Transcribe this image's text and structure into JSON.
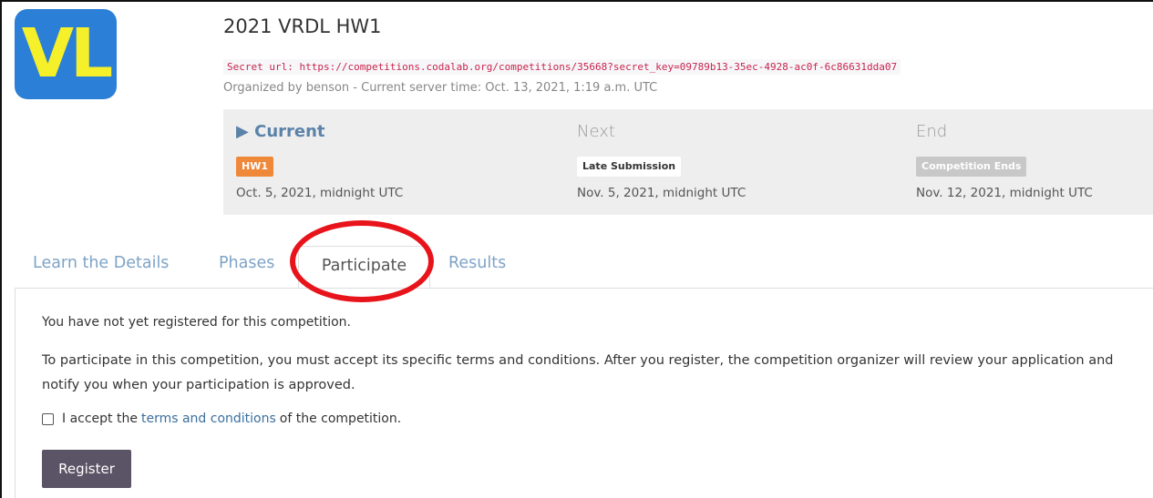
{
  "logo": {
    "text": "VL",
    "colors": {
      "background": "#2b7fd6",
      "letters": "#f5f02a"
    }
  },
  "header": {
    "title": "2021 VRDL HW1",
    "secret_label": "Secret url:",
    "secret_url": "https://competitions.codalab.org/competitions/35668?secret_key=09789b13-35ec-4928-ac0f-6c86631dda07",
    "organized_by": "Organized by benson - Current server time: Oct. 13, 2021, 1:19 a.m. UTC"
  },
  "phases": {
    "current": {
      "heading": "▶ Current",
      "badge": "HW1",
      "date": "Oct. 5, 2021, midnight UTC",
      "badge_color": "#f0883a"
    },
    "next": {
      "heading": "Next",
      "badge": "Late Submission",
      "date": "Nov. 5, 2021, midnight UTC"
    },
    "end": {
      "heading": "End",
      "badge": "Competition Ends",
      "date": "Nov. 12, 2021, midnight UTC"
    }
  },
  "tabs": {
    "details": "Learn the Details",
    "phases": "Phases",
    "participate": "Participate",
    "results": "Results",
    "active": "Participate",
    "highlight_color": "#e8141b"
  },
  "participate": {
    "not_registered": "You have not yet registered for this competition.",
    "terms_text": "To participate in this competition, you must accept its specific terms and conditions. After you register, the competition organizer will review your application and notify you when your participation is approved.",
    "accept_prefix": "I accept the",
    "accept_link": "terms and conditions",
    "accept_suffix": "of the competition.",
    "accept_checked": false,
    "register_label": "Register",
    "register_color": "#5b5366"
  }
}
